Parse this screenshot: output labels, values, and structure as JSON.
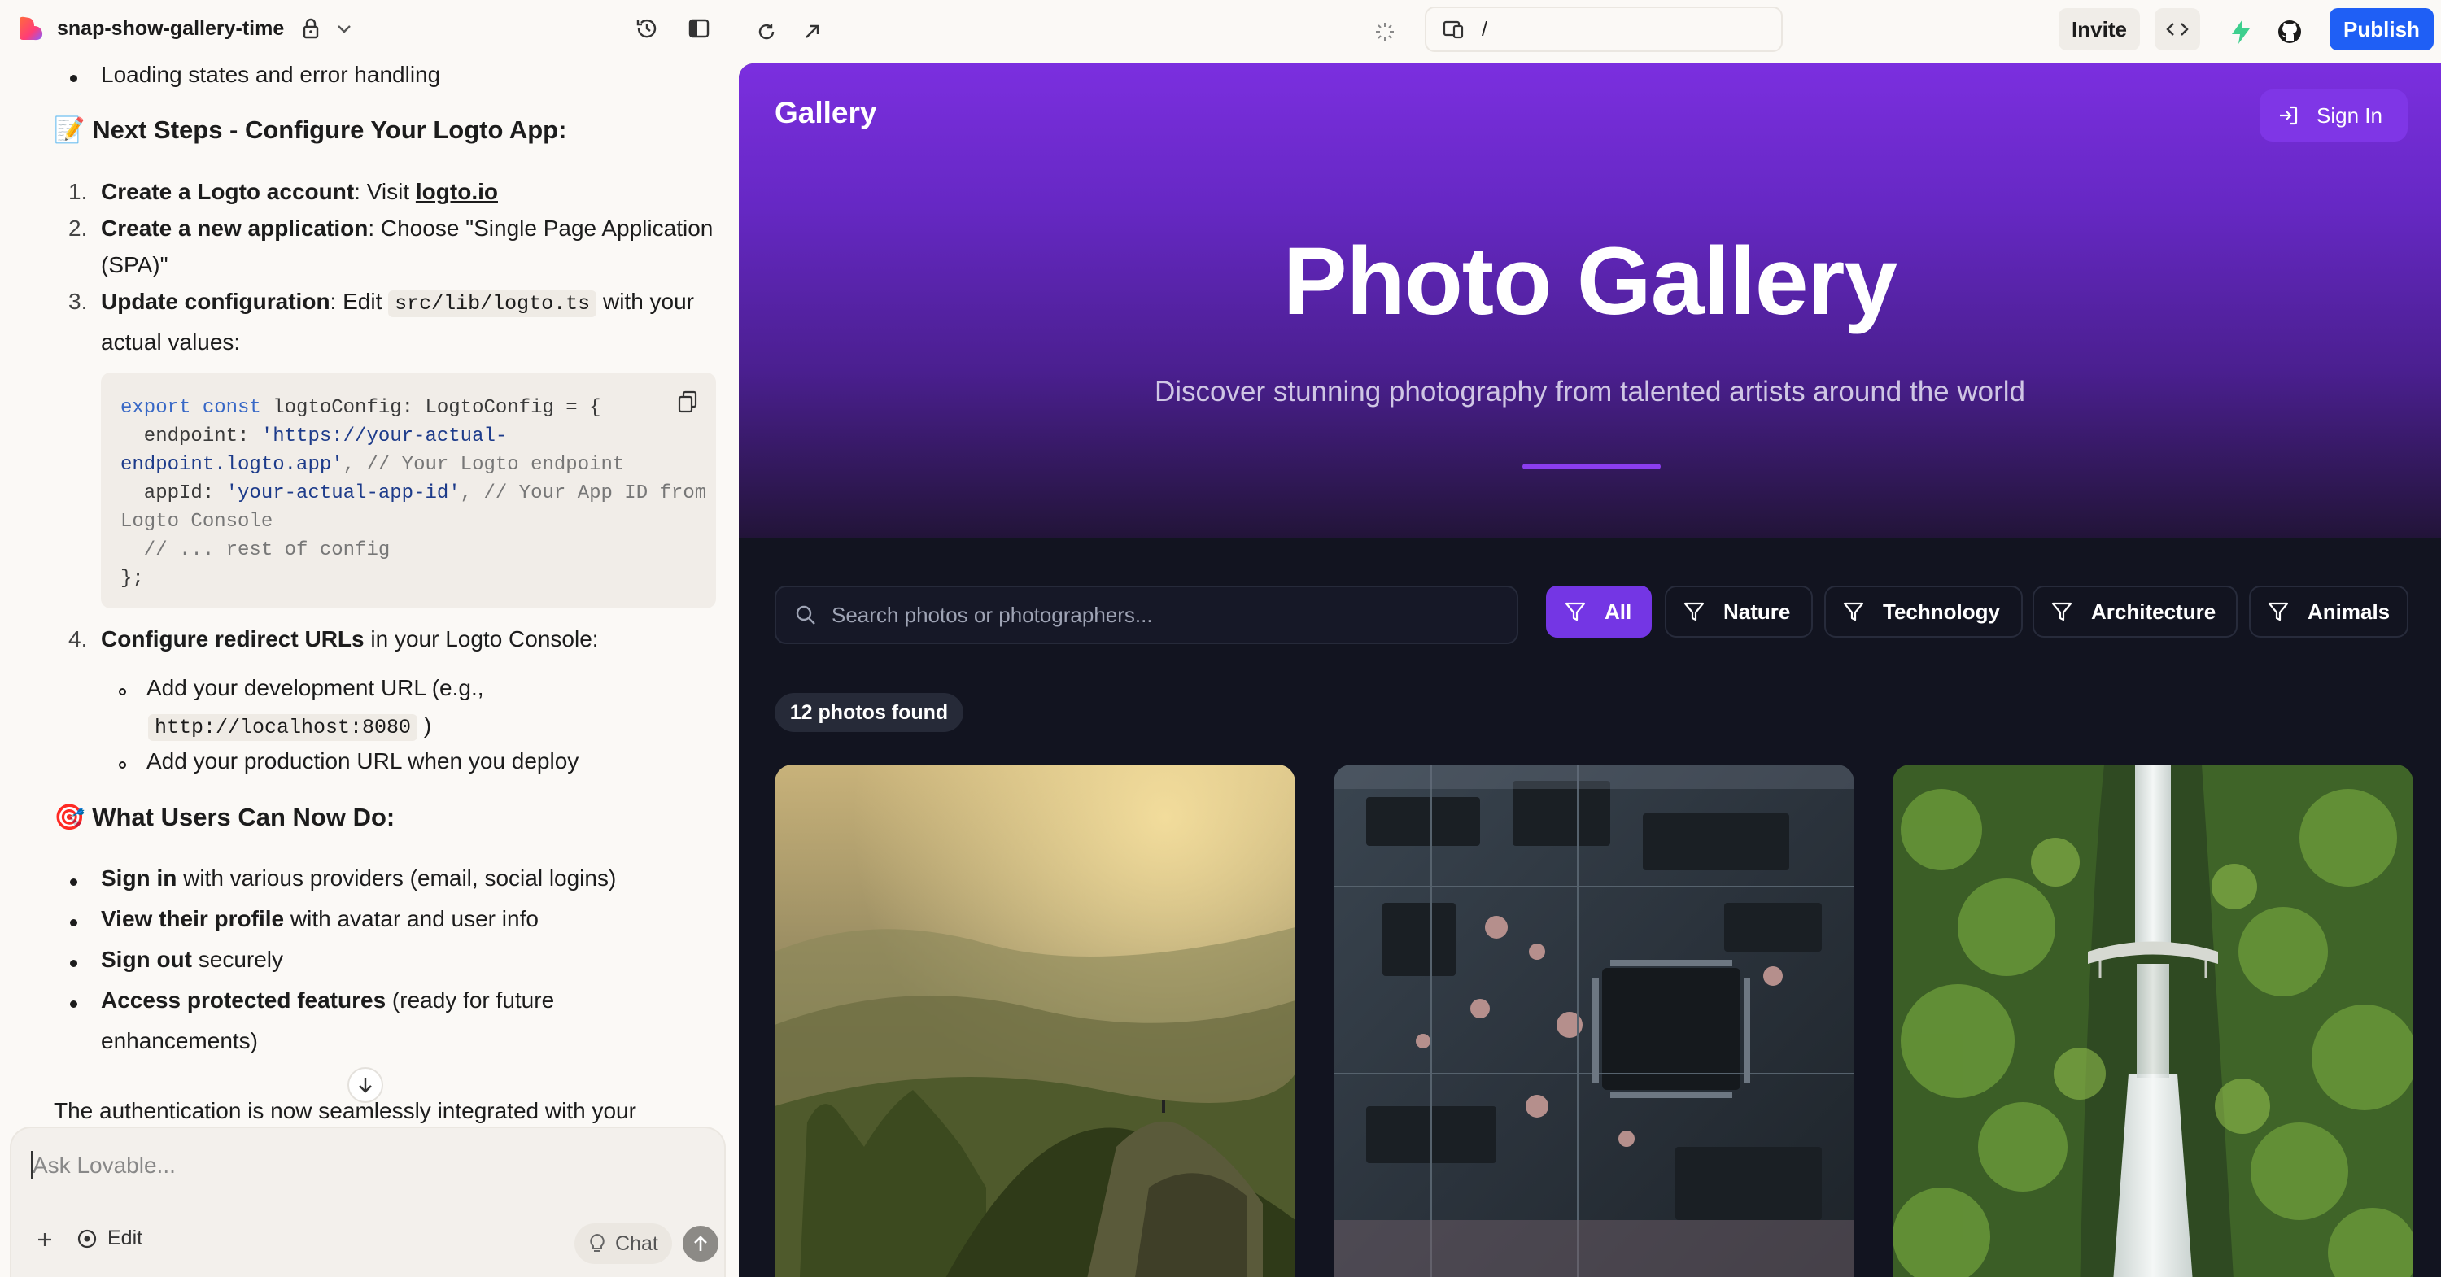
{
  "project": {
    "name": "snap-show-gallery-time"
  },
  "chat": {
    "prev_bullet": "Loading states and error handling",
    "next_steps_heading": "📝 Next Steps - Configure Your Logto App:",
    "steps": [
      {
        "num": "1.",
        "bold": "Create a Logto account",
        "rest": ": Visit ",
        "link": "logto.io"
      },
      {
        "num": "2.",
        "bold": "Create a new application",
        "rest": ": Choose \"Single Page Application",
        "rest2": "(SPA)\""
      },
      {
        "num": "3.",
        "bold": "Update configuration",
        "rest": ": Edit ",
        "code": "src/lib/logto.ts",
        "rest2": " with your",
        "rest3": "actual values:"
      },
      {
        "num": "4.",
        "bold": "Configure redirect URLs",
        "rest": " in your Logto Console:"
      }
    ],
    "code_lines": {
      "l1_kw": "export const",
      "l1_rest": " logtoConfig: LogtoConfig = {",
      "l2_a": "  endpoint: ",
      "l2_str": "'https://your-actual-",
      "l3_str": "endpoint.logto.app'",
      "l3_cm": ", // Your Logto endpoint",
      "l4_a": "  appId: ",
      "l4_str": "'your-actual-app-id'",
      "l4_cm": ", // Your App ID from",
      "l5_cm": "Logto Console",
      "l6_cm": "  // ... rest of config",
      "l7": "};"
    },
    "sub_bullets": {
      "dev_url_a": "Add your development URL (e.g.,",
      "dev_url_code": "http://localhost:8080",
      "dev_url_b": " )",
      "prod_url": "Add your production URL when you deploy"
    },
    "users_heading": "🎯 What Users Can Now Do:",
    "user_items": [
      {
        "bold": "Sign in",
        "rest": " with various providers (email, social logins)"
      },
      {
        "bold": "View their profile",
        "rest": " with avatar and user info"
      },
      {
        "bold": "Sign out",
        "rest": " securely"
      },
      {
        "bold": "Access protected features",
        "rest": " (ready for future",
        "rest2": "enhancements)"
      }
    ],
    "footer_text": "The authentication is now seamlessly integrated with your"
  },
  "composer": {
    "placeholder": "Ask Lovable...",
    "edit_label": "Edit",
    "chat_label": "Chat"
  },
  "topbar": {
    "url_path": "/",
    "invite_label": "Invite",
    "publish_label": "Publish"
  },
  "app": {
    "brand": "Gallery",
    "signin_label": "Sign In",
    "hero_title": "Photo Gallery",
    "hero_subtitle": "Discover stunning photography from talented artists around the world",
    "search_placeholder": "Search photos or photographers...",
    "filters": [
      "All",
      "Nature",
      "Technology",
      "Architecture",
      "Animals"
    ],
    "active_filter": "All",
    "count_text": "12 photos found",
    "photos": [
      "mountain-landscape",
      "circuit-board",
      "waterfall-bridge"
    ]
  },
  "colors": {
    "accent_purple": "#7436e4",
    "publish_blue": "#1f5ff5",
    "preview_bg": "#121420"
  }
}
